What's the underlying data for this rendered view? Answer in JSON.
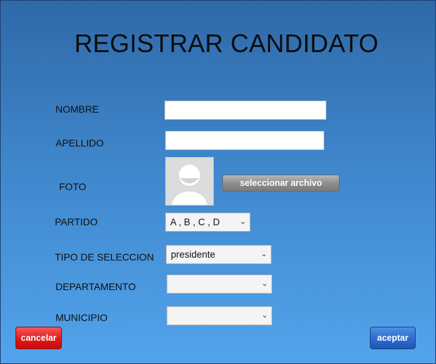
{
  "form": {
    "title": "REGISTRAR CANDIDATO",
    "nombre": {
      "label": "NOMBRE",
      "value": ""
    },
    "apellido": {
      "label": "APELLIDO",
      "value": ""
    },
    "foto": {
      "label": "FOTO",
      "button_label": "seleccionar archivo",
      "avatar_icon": "user-avatar-placeholder-icon"
    },
    "partido": {
      "label": "PARTIDO",
      "selected": "A , B , C , D"
    },
    "tipo_seleccion": {
      "label": "TIPO DE SELECCION",
      "selected": "presidente"
    },
    "departamento": {
      "label": "DEPARTAMENTO",
      "selected": ""
    },
    "municipio": {
      "label": "MUNICIPIO",
      "selected": ""
    }
  },
  "actions": {
    "cancel_label": "cancelar",
    "accept_label": "aceptar"
  },
  "colors": {
    "background_top": "#2f69a8",
    "background_bottom": "#52a4ec",
    "cancel_button": "#e01818",
    "accept_button": "#2c6cd0",
    "file_button": "#8e8e8e"
  }
}
